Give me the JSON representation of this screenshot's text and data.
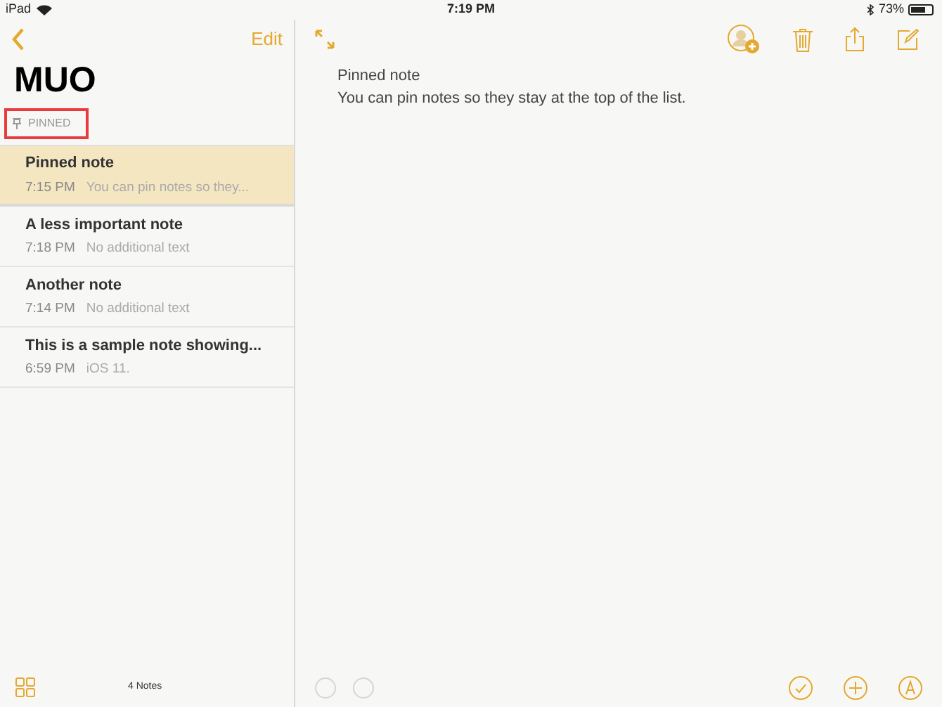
{
  "status_bar": {
    "device": "iPad",
    "time": "7:19 PM",
    "battery": "73%"
  },
  "sidebar": {
    "edit": "Edit",
    "title": "MUO",
    "section": {
      "label": "PINNED",
      "highlighted": true
    },
    "notes": [
      {
        "title": "Pinned note",
        "time": "7:15 PM",
        "preview": "You can pin notes so they...",
        "selected": true
      },
      {
        "title": "A less important note",
        "time": "7:18 PM",
        "preview": "No additional text",
        "selected": false
      },
      {
        "title": "Another note",
        "time": "7:14 PM",
        "preview": "No additional text",
        "selected": false
      },
      {
        "title": "This is a sample note showing...",
        "time": "6:59 PM",
        "preview": "iOS 11.",
        "selected": false
      }
    ],
    "count": "4 Notes"
  },
  "editor": {
    "lines": [
      "Pinned note",
      "You can pin notes so they stay at the top of the list."
    ]
  }
}
